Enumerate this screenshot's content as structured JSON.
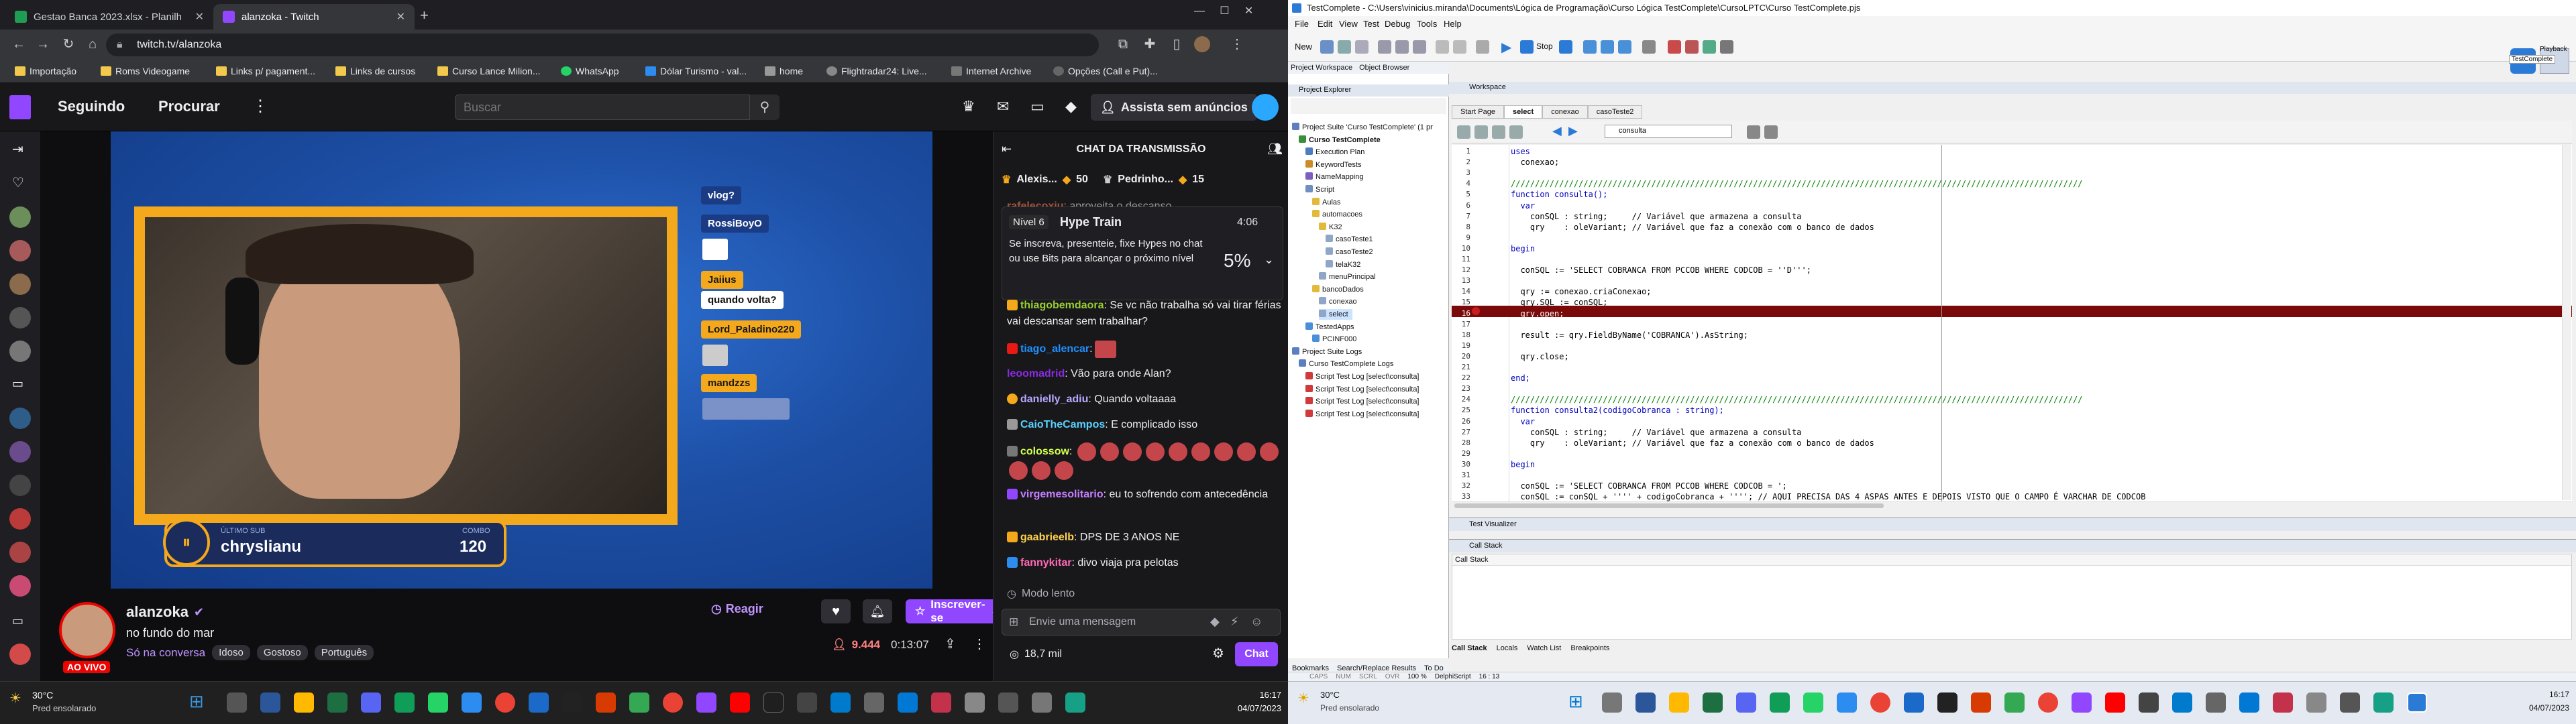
{
  "left": {
    "chrome": {
      "tabs": [
        {
          "title": "Gestao Banca 2023.xlsx - Planilh",
          "active": false,
          "color": "#1f9d55"
        },
        {
          "title": "alanzoka - Twitch",
          "active": true,
          "color": "#9147ff"
        }
      ],
      "new_tab": "+",
      "url": "twitch.tv/alanzoka",
      "bookmarks": [
        "Importação",
        "Roms Videogame",
        "Links p/ pagament...",
        "Links de cursos",
        "Curso Lance Milion...",
        "WhatsApp",
        "Dólar Turismo - val...",
        "home",
        "Flightradar24: Live...",
        "Internet Archive",
        "Opções (Call e Put)..."
      ]
    },
    "twitch": {
      "nav": {
        "following": "Seguindo",
        "browse": "Procurar",
        "search_placeholder": "Buscar",
        "ad_free": "Assista sem anúncios"
      },
      "overlay": {
        "sub_names": [
          "vlog?",
          "RossiBoyO",
          "Jaiius",
          "quando volta?",
          "Lord_Paladino220",
          "mandzzs"
        ],
        "last_sub_label": "ÚLTIMO SUB",
        "last_sub_name": "chryslianu",
        "combo_label": "COMBO",
        "combo_value": "120"
      },
      "stream": {
        "channel": "alanzoka",
        "title": "no fundo do mar",
        "category": "Só na conversa",
        "tags": [
          "Idoso",
          "Gostoso",
          "Português"
        ],
        "live_badge": "AO VIVO",
        "react": "Reagir",
        "subscribe": "Inscrever-se",
        "viewers": "9.444",
        "uptime": "0:13:07"
      },
      "chat": {
        "header": "CHAT DA TRANSMISSÃO",
        "leaders": [
          {
            "name": "Alexis...",
            "count": "50"
          },
          {
            "name": "Pedrinho...",
            "count": "15"
          }
        ],
        "hype_train": {
          "level": "Nível 6",
          "title": "Hype Train",
          "timer": "4:06",
          "text": "Se inscreva, presenteie, fixe Hypes no chat ou use Bits para alcançar o próximo nível",
          "percent": "5%"
        },
        "messages": [
          {
            "user": "rafelecoxiu",
            "text": ": aproveita o descanso",
            "color": "#ff7f50"
          },
          {
            "user": "thiagobemdaora",
            "text": ": Se vc não trabalha só vai tirar férias vai descansar sem trabalhar?",
            "color": "#9acd32"
          },
          {
            "user": "tiago_alencar",
            "text": ":",
            "color": "#1e90ff"
          },
          {
            "user": "leoomadrid",
            "text": ": Vão para onde Alan?",
            "color": "#8a2be2"
          },
          {
            "user": "danielly_adiu",
            "text": ": Quando voltaaaa",
            "color": "#b8a9ff"
          },
          {
            "user": "CaioTheCampos",
            "text": ": E complicado isso",
            "color": "#5ad1ff"
          },
          {
            "user": "colossow",
            "text": ":",
            "color": "#d2ff4d"
          },
          {
            "user": "virgemesolitario",
            "text": ": eu to sofrendo com antecedência",
            "color": "#c77dff"
          },
          {
            "user": "gaabrieelb",
            "text": ": DPS DE 3 ANOS NE",
            "color": "#ffd24d"
          },
          {
            "user": "fannykitar",
            "text": ": divo viaja pra pelotas",
            "color": "#ff69b4"
          }
        ],
        "slow_mode": "Modo lento",
        "input_placeholder": "Envie uma mensagem",
        "points": "18,7 mil",
        "send": "Chat"
      }
    },
    "taskbar": {
      "weather_temp": "30°C",
      "weather_desc": "Pred ensolarado",
      "time": "16:17",
      "date": "04/07/2023"
    }
  },
  "right": {
    "title": "TestComplete - C:\\Users\\vinicius.miranda\\Documents\\Lógica de Programação\\Curso Lógica TestComplete\\CursoLPTC\\Curso TestComplete.pjs",
    "menu": [
      "File",
      "Edit",
      "View",
      "Test",
      "Debug",
      "Tools",
      "Help"
    ],
    "toolbar": {
      "new": "New",
      "stop": "Stop"
    },
    "side_tabs": [
      "Project Workspace",
      "Object Browser"
    ],
    "project_explorer": {
      "header": "Project Explorer",
      "tree": [
        {
          "label": "Project Suite 'Curso TestComplete' (1 pr",
          "level": 0,
          "color": "#5b7fbf"
        },
        {
          "label": "Curso TestComplete",
          "level": 1,
          "color": "#3a8f3a",
          "bold": true
        },
        {
          "label": "Execution Plan",
          "level": 2,
          "color": "#4e7cc0"
        },
        {
          "label": "KeywordTests",
          "level": 2,
          "color": "#c98c28"
        },
        {
          "label": "NameMapping",
          "level": 2,
          "color": "#7b5fbf"
        },
        {
          "label": "Script",
          "level": 2,
          "color": "#6f8fbf"
        },
        {
          "label": "Aulas",
          "level": 3,
          "color": "#e2b93b"
        },
        {
          "label": "automacoes",
          "level": 3,
          "color": "#e2b93b"
        },
        {
          "label": "K32",
          "level": 4,
          "color": "#e2b93b"
        },
        {
          "label": "casoTeste1",
          "level": 5,
          "color": "#8fa6c8"
        },
        {
          "label": "casoTeste2",
          "level": 5,
          "color": "#8fa6c8"
        },
        {
          "label": "telaK32",
          "level": 5,
          "color": "#8fa6c8"
        },
        {
          "label": "menuPrincipal",
          "level": 4,
          "color": "#8fa6c8"
        },
        {
          "label": "bancoDados",
          "level": 3,
          "color": "#e2b93b"
        },
        {
          "label": "conexao",
          "level": 4,
          "color": "#8fa6c8"
        },
        {
          "label": "select",
          "level": 4,
          "color": "#8fa6c8",
          "selected": true
        },
        {
          "label": "TestedApps",
          "level": 2,
          "color": "#4a90d9"
        },
        {
          "label": "PCINF000",
          "level": 3,
          "color": "#4a90d9"
        },
        {
          "label": "Project Suite Logs",
          "level": 0,
          "color": "#5b7fbf"
        },
        {
          "label": "Curso TestComplete Logs",
          "level": 1,
          "color": "#5b7fbf"
        },
        {
          "label": "Script Test Log [select\\consulta]",
          "level": 2,
          "color": "#d03a3a"
        },
        {
          "label": "Script Test Log [select\\consulta]",
          "level": 2,
          "color": "#d03a3a"
        },
        {
          "label": "Script Test Log [select\\consulta]",
          "level": 2,
          "color": "#d03a3a"
        },
        {
          "label": "Script Test Log [select\\consulta]",
          "level": 2,
          "color": "#d03a3a"
        }
      ]
    },
    "workspace": {
      "header": "Workspace",
      "tabs": [
        "Start Page",
        "select",
        "conexao",
        "casoTeste2"
      ],
      "routine_select": "consulta",
      "code_lines": [
        "uses",
        "  conexao;",
        "",
        "//////////////////////////////////////////////////////////////////////////////////////////////////////////////////////",
        "function consulta();",
        "  var",
        "    conSQL : string;     // Variável que armazena a consulta",
        "    qry    : oleVariant; // Variável que faz a conexão com o banco de dados",
        "",
        "begin",
        "",
        "  conSQL := 'SELECT COBRANCA FROM PCCOB WHERE CODCOB = ''D''';",
        "",
        "  qry := conexao.criaConexao;",
        "  qry.SQL := conSQL;",
        "  qry.open;",
        "",
        "  result := qry.FieldByName('COBRANCA').AsString;",
        "",
        "  qry.close;",
        "",
        "end;",
        "",
        "//////////////////////////////////////////////////////////////////////////////////////////////////////////////////////",
        "function consulta2(codigoCobranca : string);",
        "  var",
        "    conSQL : string;     // Variável que armazena a consulta",
        "    qry    : oleVariant; // Variável que faz a conexão com o banco de dados",
        "",
        "begin",
        "",
        "  conSQL := 'SELECT COBRANCA FROM PCCOB WHERE CODCOB = ';",
        "  conSQL := conSQL + '''' + codigoCobranca + ''''; // AQUI PRECISA DAS 4 ASPAS ANTES E DEPOIS VISTO QUE O CAMPO É VARCHAR DE CODCOB"
      ],
      "breakpoint_line": 16
    },
    "panels": {
      "test_visualizer": "Test Visualizer",
      "call_stack_header": "Call Stack",
      "call_stack_col": "Call Stack"
    },
    "bottom_tabs": [
      "Call Stack",
      "Locals",
      "Watch List",
      "Breakpoints"
    ],
    "left_bottom_tabs": [
      "Bookmarks",
      "Search/Replace Results",
      "To Do"
    ],
    "status": {
      "caps": "CAPS",
      "num": "NUM",
      "scrl": "SCRL",
      "ovr": "OVR",
      "zoom": "100 %",
      "language": "DelphiScript",
      "position": "16 : 13"
    },
    "right_overlay": {
      "playback": "Playback",
      "testcomplete": "TestComplete"
    },
    "taskbar": {
      "weather_temp": "30°C",
      "weather_desc": "Pred ensolarado",
      "time": "16:17",
      "date": "04/07/2023"
    }
  }
}
